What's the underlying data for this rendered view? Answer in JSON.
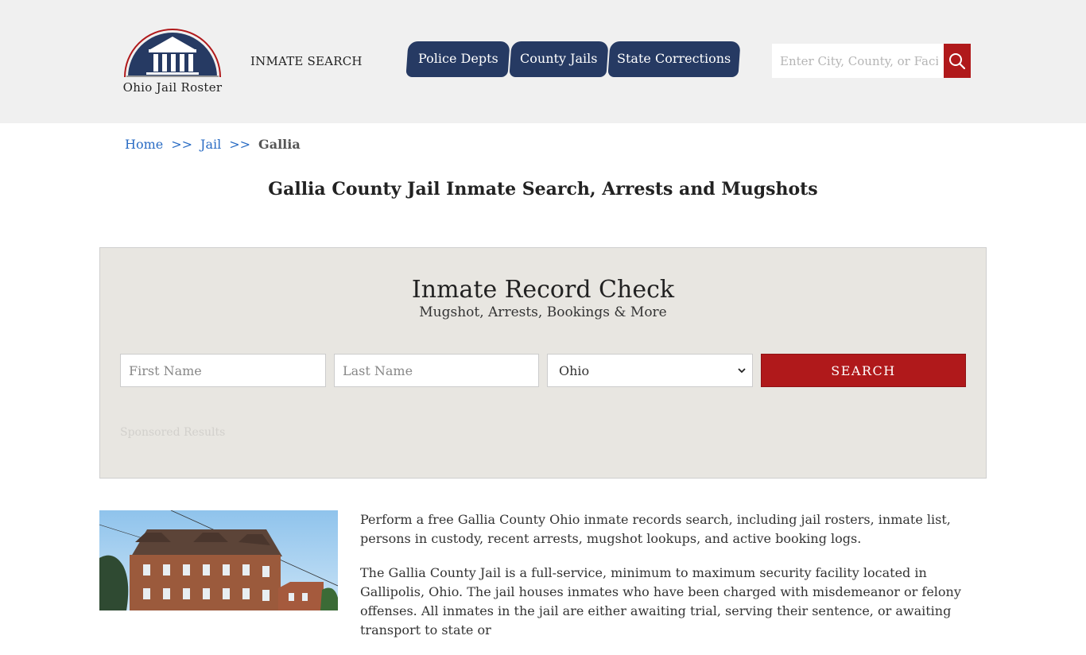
{
  "header": {
    "logo_text": "Ohio Jail Roster",
    "inmate_search_label": "INMATE SEARCH",
    "nav": [
      {
        "label": "Police Depts"
      },
      {
        "label": "County Jails"
      },
      {
        "label": "State Corrections"
      }
    ],
    "search_placeholder": "Enter City, County, or Facility"
  },
  "breadcrumb": {
    "items": [
      "Home",
      "Jail"
    ],
    "separator": ">>",
    "current": "Gallia"
  },
  "page_title": "Gallia County Jail Inmate Search, Arrests and Mugshots",
  "record_check": {
    "title": "Inmate Record Check",
    "subtitle": "Mugshot, Arrests, Bookings & More",
    "first_name_placeholder": "First Name",
    "last_name_placeholder": "Last Name",
    "state_value": "Ohio",
    "search_button": "SEARCH",
    "sponsored_label": "Sponsored Results"
  },
  "content": {
    "paragraph_1": "Perform a free Gallia County Ohio inmate records search, including jail rosters, inmate list, persons in custody, recent arrests, mugshot lookups, and active booking logs.",
    "paragraph_2": "The Gallia County Jail is a full-service, minimum to maximum security facility located in Gallipolis, Ohio. The jail houses inmates who have been charged with misdemeanor or felony offenses. All inmates in the jail are either awaiting trial, serving their sentence, or awaiting transport to state or"
  },
  "colors": {
    "nav_bg": "#263a63",
    "accent_red": "#b0191b",
    "header_bg": "#f0f0f0",
    "panel_bg": "#e8e6e1",
    "link_blue": "#2a6cc4"
  }
}
